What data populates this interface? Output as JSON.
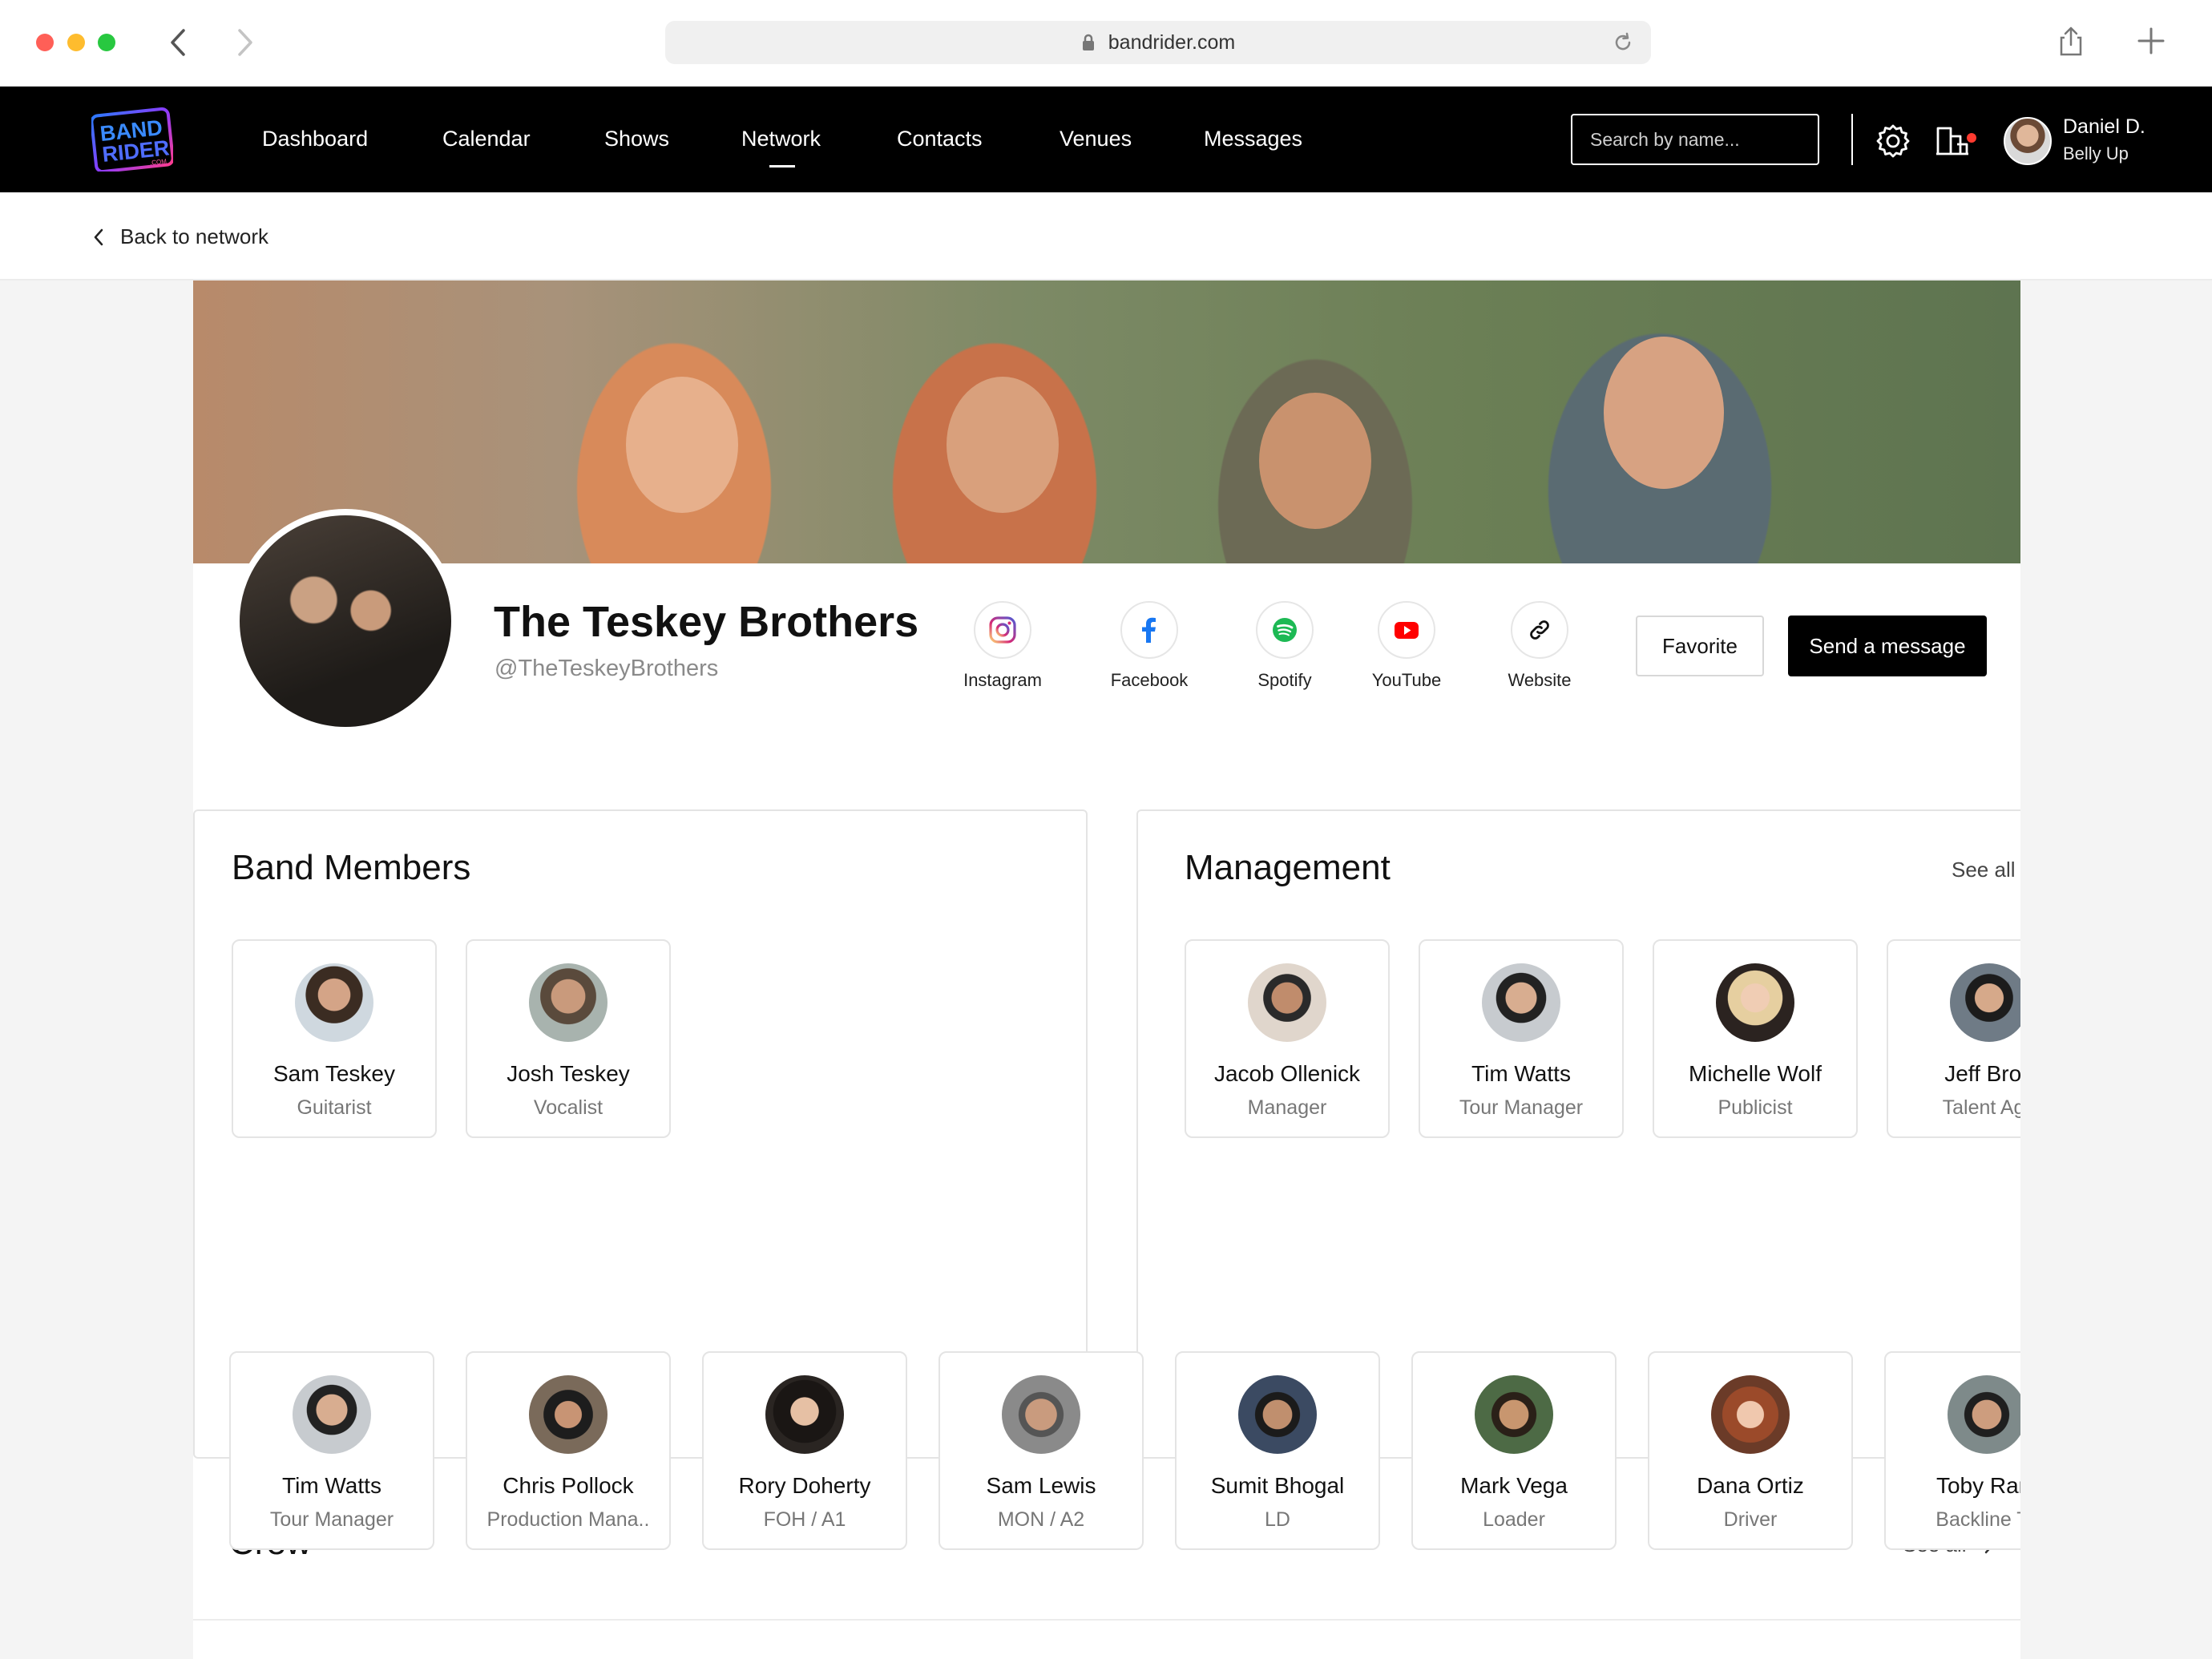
{
  "browser": {
    "url": "bandrider.com"
  },
  "nav": {
    "logo_text": "BAND RIDER .COM",
    "links": [
      {
        "label": "Dashboard"
      },
      {
        "label": "Calendar"
      },
      {
        "label": "Shows"
      },
      {
        "label": "Network",
        "active": true
      },
      {
        "label": "Contacts"
      },
      {
        "label": "Venues"
      },
      {
        "label": "Messages"
      }
    ],
    "search_placeholder": "Search by name...",
    "icons": [
      "gear-icon",
      "venue-icon"
    ],
    "notification_dot_color": "#ff3b30",
    "user": {
      "name": "Daniel D.",
      "org": "Belly Up"
    }
  },
  "back": {
    "label": "Back to network"
  },
  "profile": {
    "name": "The Teskey Brothers",
    "handle": "@TheTeskeyBrothers",
    "socials": [
      {
        "label": "Instagram",
        "icon": "instagram-icon",
        "color": "#e1306c"
      },
      {
        "label": "Facebook",
        "icon": "facebook-icon",
        "color": "#1877f2"
      },
      {
        "label": "Spotify",
        "icon": "spotify-icon",
        "color": "#1db954"
      },
      {
        "label": "YouTube",
        "icon": "youtube-icon",
        "color": "#ff0000"
      },
      {
        "label": "Website",
        "icon": "link-icon",
        "color": "#111111"
      }
    ],
    "favorite_label": "Favorite",
    "message_label": "Send a message"
  },
  "band_members": {
    "title": "Band Members",
    "people": [
      {
        "name": "Sam Teskey",
        "role": "Guitarist"
      },
      {
        "name": "Josh Teskey",
        "role": "Vocalist"
      }
    ]
  },
  "management": {
    "title": "Management",
    "see_all": "See all",
    "people": [
      {
        "name": "Jacob Ollenick",
        "role": "Manager"
      },
      {
        "name": "Tim Watts",
        "role": "Tour Manager"
      },
      {
        "name": "Michelle Wolf",
        "role": "Publicist"
      },
      {
        "name": "Jeff Broo",
        "role": "Talent Age"
      }
    ]
  },
  "crew": {
    "title": "Crew",
    "see_all": "See all",
    "people": [
      {
        "name": "Tim Watts",
        "role": "Tour Manager"
      },
      {
        "name": "Chris Pollock",
        "role": "Production Mana.."
      },
      {
        "name": "Rory Doherty",
        "role": "FOH / A1"
      },
      {
        "name": "Sam Lewis",
        "role": "MON / A2"
      },
      {
        "name": "Sumit Bhogal",
        "role": "LD"
      },
      {
        "name": "Mark Vega",
        "role": "Loader"
      },
      {
        "name": "Dana Ortiz",
        "role": "Driver"
      },
      {
        "name": "Toby Ram",
        "role": "Backline Te"
      }
    ]
  }
}
